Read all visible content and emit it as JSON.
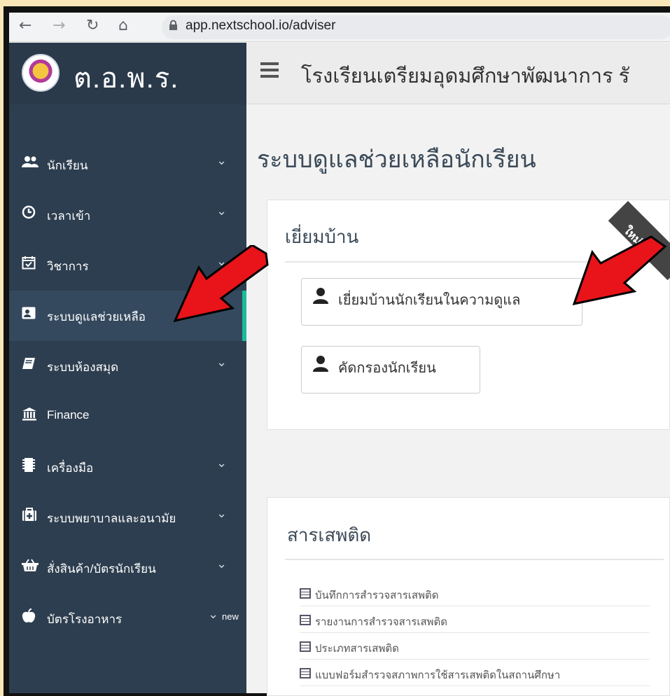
{
  "browser": {
    "url": "app.nextschool.io/adviser",
    "icons": [
      "back-arrow-icon",
      "forward-arrow-icon",
      "reload-icon",
      "home-icon",
      "lock-icon"
    ]
  },
  "sidebar": {
    "brand": "ต.อ.พ.ร.",
    "items": [
      {
        "label": "นักเรียน",
        "icon": "users-icon",
        "chevron": true
      },
      {
        "label": "เวลาเข้า",
        "icon": "clock-icon",
        "chevron": true
      },
      {
        "label": "วิชาการ",
        "icon": "calendar-check-icon",
        "chevron": true
      },
      {
        "label": "ระบบดูแลช่วยเหลือ",
        "icon": "contact-card-icon",
        "chevron": false,
        "active": true
      },
      {
        "label": "ระบบห้องสมุด",
        "icon": "book-icon",
        "chevron": true
      },
      {
        "label": "Finance",
        "icon": "bank-icon",
        "chevron": false
      },
      {
        "label": "เครื่องมือ",
        "icon": "chip-icon",
        "chevron": true
      },
      {
        "label": "ระบบพยาบาลและอนามัย",
        "icon": "medkit-icon",
        "chevron": true
      },
      {
        "label": "สั่งสินค้า/บัตรนักเรียน",
        "icon": "basket-icon",
        "chevron": true
      },
      {
        "label": "บัตรโรงอาหาร",
        "icon": "apple-icon",
        "chevron": true,
        "badge": "new"
      }
    ]
  },
  "topbar": {
    "school": "โรงเรียนเตรียมอุดมศึกษาพัฒนาการ รั"
  },
  "main": {
    "title": "ระบบดูแลช่วยเหลือนักเรียน",
    "home_visit": {
      "title": "เยี่ยมบ้าน",
      "ribbon": "ใหม่",
      "buttons": [
        "เยี่ยมบ้านนักเรียนในความดูแล",
        "คัดกรองนักเรียน"
      ]
    },
    "drugs": {
      "title": "สารเสพติด",
      "links": [
        "บันทึกการสำรวจสารเสพติด",
        "รายงานการสำรวจสารเสพติด",
        "ประเภทสารเสพติด",
        "แบบฟอร์มสำรวจสภาพการใช้สารเสพติดในสถานศึกษา"
      ]
    }
  },
  "colors": {
    "sidebar": "#2d3e50",
    "active_accent": "#1abc9c",
    "arrow": "#e8141a",
    "background_border": "#f8e6b8"
  }
}
